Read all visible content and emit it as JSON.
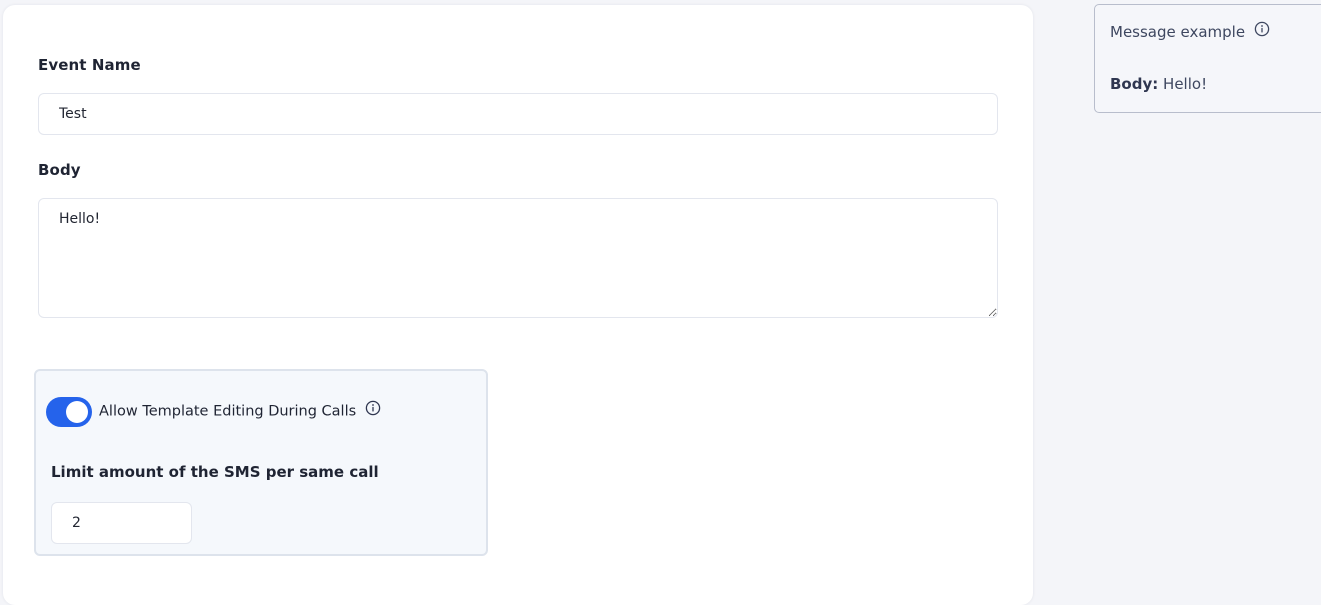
{
  "form": {
    "event_name": {
      "label": "Event Name",
      "value": "Test"
    },
    "body": {
      "label": "Body",
      "value": "Hello!"
    }
  },
  "settings": {
    "allow_editing": {
      "label": "Allow Template Editing During Calls",
      "enabled": true,
      "info_icon": "info-circle-icon"
    },
    "limit": {
      "label": "Limit amount of the SMS per same call",
      "value": "2"
    }
  },
  "preview": {
    "title": "Message example",
    "info_icon": "info-circle-icon",
    "body_label": "Body:",
    "body_value": "Hello!"
  },
  "colors": {
    "accent": "#2563eb",
    "background": "#f4f5f9",
    "card": "#ffffff",
    "panel": "#f5f8fc",
    "border": "#e3e6ee"
  }
}
